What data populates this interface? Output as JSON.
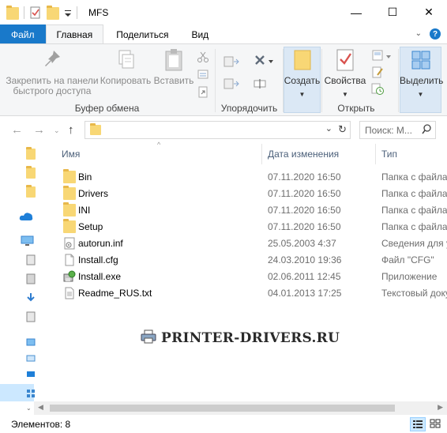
{
  "window": {
    "title": "MFS",
    "minimize_glyph": "—",
    "maximize_glyph": "☐",
    "close_glyph": "✕"
  },
  "ribbon_tabs": {
    "file": "Файл",
    "home": "Главная",
    "share": "Поделиться",
    "view": "Вид"
  },
  "ribbon": {
    "pin_label": "Закрепить на панели быстрого доступа",
    "copy_label": "Копировать",
    "paste_label": "Вставить",
    "clipboard_group": "Буфер обмена",
    "organize_group": "Упорядочить",
    "new_label": "Создать",
    "properties_label": "Свойства",
    "open_group": "Открыть",
    "select_label": "Выделить"
  },
  "address": {
    "search_placeholder": "Поиск: М..."
  },
  "columns": {
    "name": "Имя",
    "date": "Дата изменения",
    "type": "Тип"
  },
  "files": [
    {
      "name": "Bin",
      "date": "07.11.2020 16:50",
      "type": "Папка с файлами",
      "icon": "folder-icon"
    },
    {
      "name": "Drivers",
      "date": "07.11.2020 16:50",
      "type": "Папка с файлами",
      "icon": "folder-icon"
    },
    {
      "name": "INI",
      "date": "07.11.2020 16:50",
      "type": "Папка с файлами",
      "icon": "folder-icon"
    },
    {
      "name": "Setup",
      "date": "07.11.2020 16:50",
      "type": "Папка с файлами",
      "icon": "folder-icon"
    },
    {
      "name": "autorun.inf",
      "date": "25.05.2003 4:37",
      "type": "Сведения для установки",
      "icon": "inf-file-icon"
    },
    {
      "name": "Install.cfg",
      "date": "24.03.2010 19:36",
      "type": "Файл \"CFG\"",
      "icon": "cfg-file-icon"
    },
    {
      "name": "Install.exe",
      "date": "02.06.2011 12:45",
      "type": "Приложение",
      "icon": "exe-installer-icon"
    },
    {
      "name": "Readme_RUS.txt",
      "date": "04.01.2013 17:25",
      "type": "Текстовый документ",
      "icon": "txt-file-icon"
    }
  ],
  "watermark": "PRINTER-DRIVERS.RU",
  "status": {
    "count": "Элементов: 8"
  },
  "colors": {
    "file_tab": "#1979ca",
    "folder": "#f8d775",
    "selection": "#cce8ff"
  }
}
